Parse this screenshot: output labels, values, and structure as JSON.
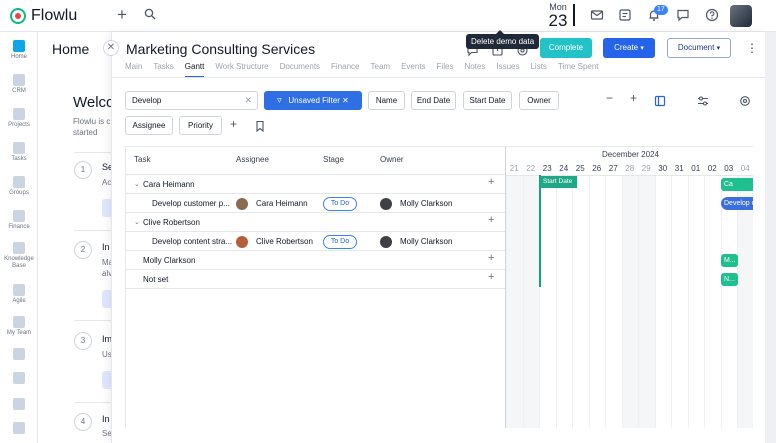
{
  "app": {
    "name": "Flowlu"
  },
  "topbar": {
    "date_month": "Mon",
    "date_day": "23",
    "notifications_count": "17"
  },
  "sidebar": {
    "items": [
      {
        "label": "Home"
      },
      {
        "label": "CRM"
      },
      {
        "label": "Projects"
      },
      {
        "label": "Tasks"
      },
      {
        "label": "Groups"
      },
      {
        "label": "Finance"
      },
      {
        "label": "Knowledge Base"
      },
      {
        "label": "Agile"
      },
      {
        "label": "My Team"
      }
    ]
  },
  "home": {
    "title": "Home",
    "welcome": "Welco",
    "welcome_sub_1": "Flowlu is c",
    "welcome_sub_2": "started",
    "steps": [
      {
        "num": "1",
        "title": "Se",
        "sub_1": "Ac",
        "sub_2": ""
      },
      {
        "num": "2",
        "title": "In",
        "sub_1": "Ma",
        "sub_2": "alv"
      },
      {
        "num": "3",
        "title": "Im",
        "sub_1": "Us",
        "sub_2": ""
      },
      {
        "num": "4",
        "title": "In",
        "sub_1": "Se",
        "sub_2": ""
      }
    ]
  },
  "project": {
    "title": "Marketing Consulting Services",
    "tooltip": "Delete demo data",
    "complete_label": "Complete",
    "create_label": "Create",
    "document_label": "Document",
    "tabs": [
      "Main",
      "Tasks",
      "Gantt",
      "Work Structure",
      "Documents",
      "Finance",
      "Team",
      "Events",
      "Files",
      "Notes",
      "Issues",
      "Lists",
      "Time Spent"
    ],
    "active_tab": "Gantt"
  },
  "filters": {
    "search_value": "Develop",
    "unsaved_filter_label": "Unsaved Filter",
    "chips": [
      "Name",
      "End Date",
      "Start Date",
      "Owner",
      "Assignee",
      "Priority"
    ]
  },
  "grid": {
    "headers": {
      "task": "Task",
      "assignee": "Assignee",
      "stage": "Stage",
      "owner": "Owner"
    },
    "rows": [
      {
        "type": "group",
        "label": "Cara Heimann"
      },
      {
        "type": "task",
        "task": "Develop customer p...",
        "assignee": "Cara Heimann",
        "stage": "To Do",
        "owner": "Molly Clarkson"
      },
      {
        "type": "group",
        "label": "Clive Robertson"
      },
      {
        "type": "task",
        "task": "Develop content stra...",
        "assignee": "Clive Robertson",
        "stage": "To Do",
        "owner": "Molly Clarkson"
      },
      {
        "type": "group-flat",
        "label": "Molly Clarkson"
      },
      {
        "type": "group-flat",
        "label": "Not set"
      }
    ]
  },
  "timeline": {
    "month": "December 2024",
    "days": [
      "21",
      "22",
      "23",
      "24",
      "25",
      "26",
      "27",
      "28",
      "29",
      "30",
      "31",
      "01",
      "02",
      "03",
      "04"
    ],
    "weekend_days": [
      "21",
      "22",
      "28",
      "29",
      "04"
    ],
    "start_date_label": "Start Date",
    "bars": [
      {
        "row": 0,
        "label": "Ca",
        "color": "#1fbf8f"
      },
      {
        "row": 1,
        "label": "Develop c",
        "color": "#3b6fe0"
      },
      {
        "row": 4,
        "label": "M...",
        "color": "#1fbf8f"
      },
      {
        "row": 5,
        "label": "N...",
        "color": "#1fbf8f"
      }
    ]
  },
  "colors": {
    "accent": "#2563eb",
    "teal": "#22c3c7",
    "green": "#1fa885"
  }
}
